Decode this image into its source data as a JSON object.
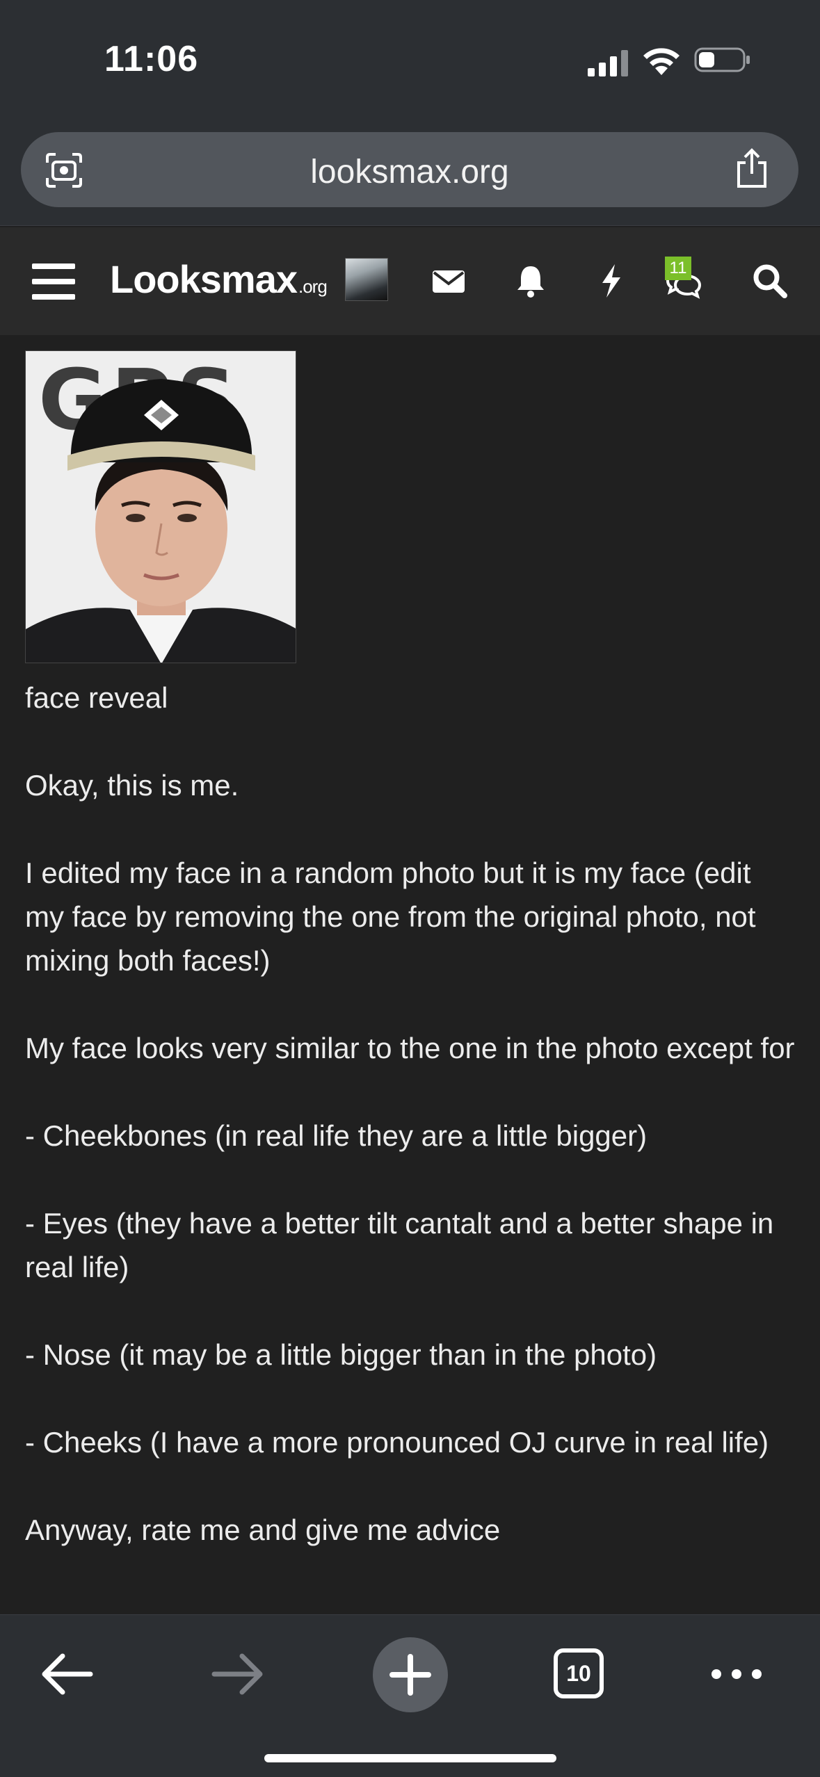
{
  "status_bar": {
    "time": "11:06",
    "icons": [
      "cellular-signal-icon",
      "wifi-icon",
      "battery-icon"
    ]
  },
  "browser": {
    "url": "looksmax.org",
    "icons": {
      "left": "camera-lens-icon",
      "right": "share-icon"
    }
  },
  "site_header": {
    "logo_main": "Looksmax",
    "logo_suffix": ".org",
    "chat_badge_count": "11",
    "icons": [
      "menu-icon",
      "avatar",
      "mail-icon",
      "bell-icon",
      "bolt-icon",
      "chat-icon",
      "search-icon"
    ]
  },
  "post": {
    "caption": "face reveal",
    "paragraphs": [
      "Okay, this is me.",
      "I edited my face in a random photo but it is my face (edit my face by removing the one from the original photo, not mixing both faces!)",
      "My face looks very similar to the one in the photo except for",
      "- Cheekbones (in real life they are a little bigger)",
      "- Eyes (they have a better tilt cantalt and a better shape in real life)",
      "- Nose (it may be a little bigger than in the photo)",
      "- Cheeks (I have a more pronounced OJ curve in real life)",
      "Anyway, rate me and give me advice"
    ]
  },
  "toolbar": {
    "tab_count": "10",
    "icons": [
      "back-arrow-icon",
      "forward-arrow-icon",
      "plus-icon",
      "tabs-icon",
      "more-icon"
    ]
  },
  "colors": {
    "chrome_bg": "#2c2f33",
    "page_bg": "#202020",
    "header_bg": "#2a2a2a",
    "badge_green": "#7bbf2a"
  }
}
